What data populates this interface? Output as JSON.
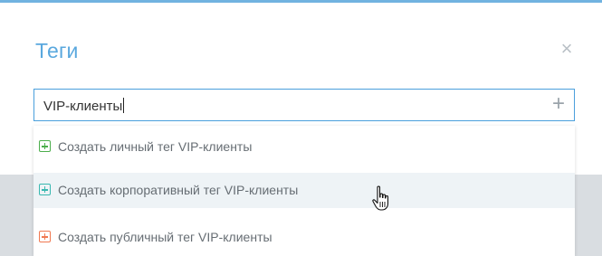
{
  "dialog": {
    "title": "Теги",
    "close_icon": "×"
  },
  "tag_input": {
    "value": "VIP-клиенты",
    "add_icon": "+"
  },
  "suggestions": [
    {
      "label": "Создать личный тег VIP-клиенты",
      "icon": "plus-square-icon",
      "color": "#4cae4c",
      "hover": false
    },
    {
      "label": "Создать корпоративный тег VIP-клиенты",
      "icon": "plus-square-icon",
      "color": "#39b8b0",
      "hover": true
    },
    {
      "label": "Создать публичный тег VIP-клиенты",
      "icon": "plus-square-icon",
      "color": "#f07850",
      "hover": false
    }
  ],
  "colors": {
    "accent": "#5aa8de",
    "input_border": "#4a9fdc",
    "hover_bg": "#eef3f6"
  }
}
